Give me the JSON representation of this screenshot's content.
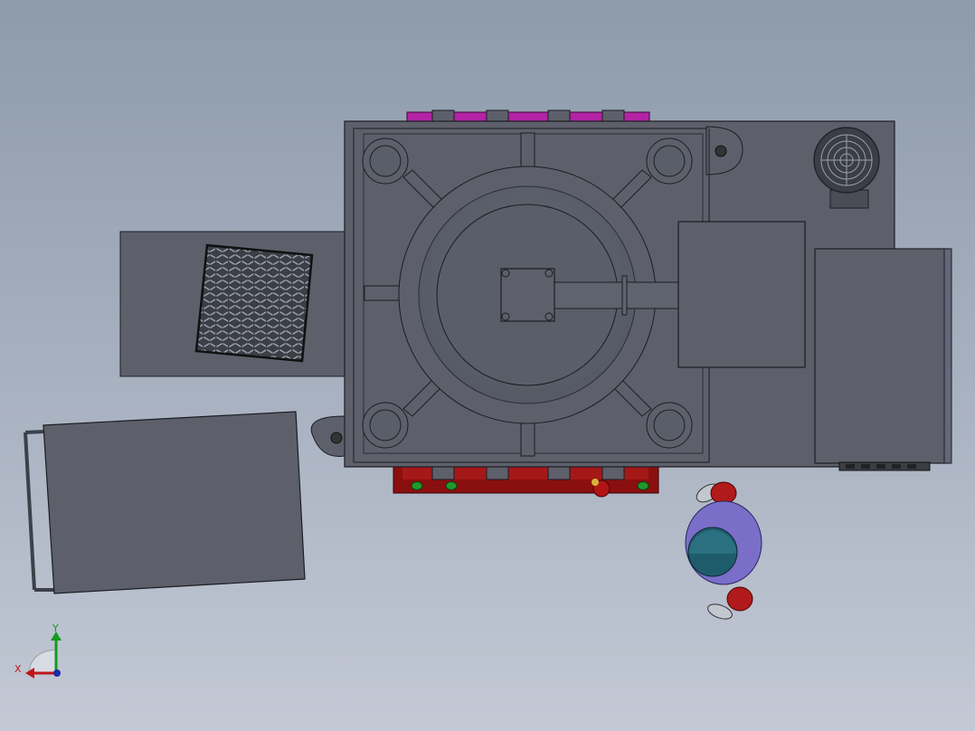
{
  "viewport": {
    "background_top": "#8d9bab",
    "background_bottom": "#c3c9d5"
  },
  "colors": {
    "body": "#5d606b",
    "edge": "#1c1d22",
    "plate": "#5a5e68",
    "accent_magenta": "#b323a4",
    "accent_red": "#8a1010",
    "accent_green": "#1f9a2a",
    "operator_shirt": "#7a6ec8",
    "operator_head": "#1f5c6b",
    "operator_arms": "#b01a1a"
  },
  "triad": {
    "x_label": "X",
    "y_label": "Y",
    "x_color": "#c0151b",
    "y_color": "#169a22",
    "z_color": "#1b2aa8"
  },
  "icons": {
    "fan": "fan-icon",
    "operator": "operator-figure-icon",
    "triad": "axis-triad-icon"
  }
}
